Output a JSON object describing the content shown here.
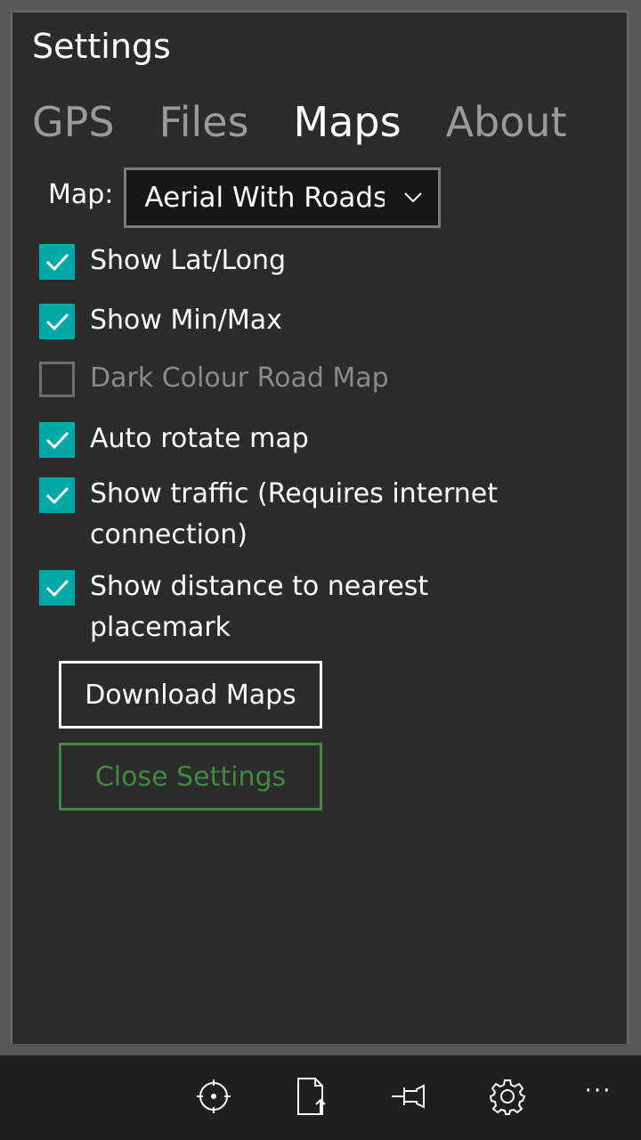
{
  "settings": {
    "title": "Settings",
    "tabs": [
      "GPS",
      "Files",
      "Maps",
      "About"
    ],
    "active_tab": "Maps",
    "map_label": "Map:",
    "map_selected": "Aerial With Roads",
    "options": [
      {
        "label": "Show Lat/Long",
        "checked": true,
        "enabled": true
      },
      {
        "label": "Show Min/Max",
        "checked": true,
        "enabled": true
      },
      {
        "label": "Dark Colour Road Map",
        "checked": false,
        "enabled": false
      },
      {
        "label": "Auto rotate map",
        "checked": true,
        "enabled": true
      },
      {
        "label": "Show traffic (Requires internet connection)",
        "checked": true,
        "enabled": true
      },
      {
        "label": "Show distance to nearest placemark",
        "checked": true,
        "enabled": true
      }
    ],
    "download_label": "Download Maps",
    "close_label": "Close Settings"
  },
  "appbar": {
    "icons": [
      "locate-icon",
      "upload-file-icon",
      "pin-icon",
      "settings-gear-icon",
      "more-icon"
    ],
    "more_label": "···"
  },
  "colors": {
    "accent": "#00a8a8",
    "close_green": "#3f8a3f",
    "panel_bg": "#2b2b2b"
  }
}
